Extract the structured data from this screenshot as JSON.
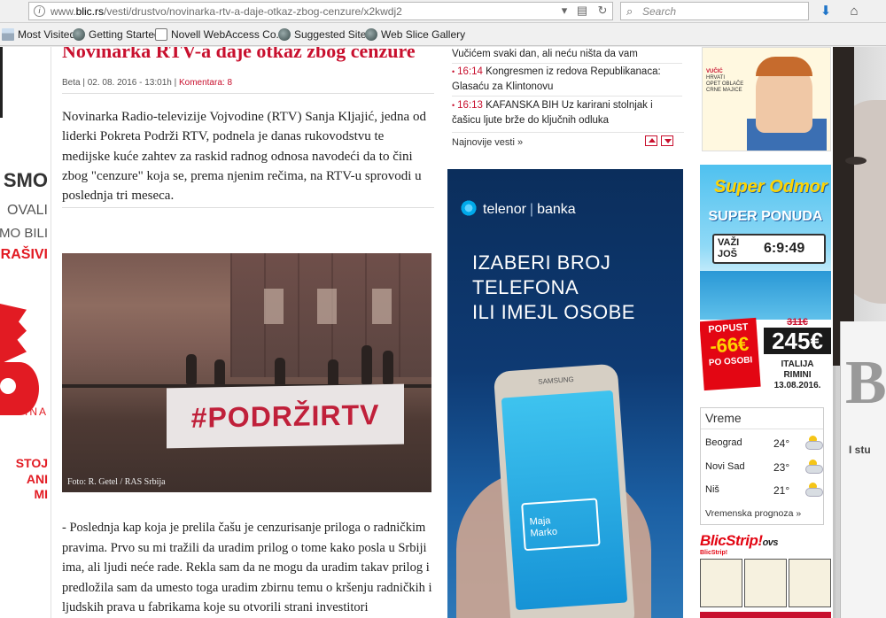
{
  "browser": {
    "url_prefix": "www.",
    "url_host": "blic.rs",
    "url_path": "/vesti/drustvo/novinarka-rtv-a-daje-otkaz-zbog-cenzure/x2kwdj2",
    "search_placeholder": "Search"
  },
  "bookmarks": [
    {
      "label": "Most Visited"
    },
    {
      "label": "Getting Started"
    },
    {
      "label": "Novell WebAccess Co..."
    },
    {
      "label": "Suggested Sites"
    },
    {
      "label": "Web Slice Gallery"
    }
  ],
  "left_skin": {
    "lines": [
      "SMO",
      "OVALI",
      "MO BILI",
      "RAŠIVI",
      "INA",
      "STOJ",
      "ANI",
      "MI"
    ]
  },
  "article": {
    "headline": "Novinarka RTV-a daje otkaz zbog cenzure",
    "source": "Beta",
    "date": "02. 08. 2016 - 13:01h",
    "comments": "Komentara: 8",
    "lead": "Novinarka Radio-televizije Vojvodine (RTV) Sanja Kljajić, jedna od liderki Pokreta Podrži RTV, podnela je danas rukovodstvu te medijske kuće zahtev za raskid radnog odnosa navodeći da to čini zbog \"cenzure\" koja se, prema njenim rečima, na RTV-u sprovodi u poslednja tri meseca.",
    "photo_banner": "#PODRŽIRTV",
    "photo_credit": "Foto: R. Getel / RAS Srbija",
    "body": "- Poslednja kap koja je prelila čašu je cenzurisanje priloga o radničkim pravima. Prvo su mi tražili da uradim prilog o tome kako posla u Srbiji ima, ali ljudi neće rade. Rekla sam da ne mogu da uradim takav prilog i predložila sam da umesto toga uradim zbirnu temu o kršenju radničkih i ljudskih prava u fabrikama koje su otvorili strani investitori"
  },
  "latest_news": {
    "items": [
      {
        "time": "",
        "text": "Vučićem svaki dan, ali neću ništa da vam"
      },
      {
        "time": "16:14",
        "text": "Kongresmen iz redova Republikanaca: Glasaću za Klintonovu"
      },
      {
        "time": "16:13",
        "text": "KAFANSKA BIH Uz karirani stolnjak i čašicu ljute brže do ključnih odluka"
      }
    ],
    "more_label": "Najnovije vesti »"
  },
  "telenor_ad": {
    "brand": "telenor",
    "brand2": "banka",
    "headline": [
      "IZABERI BROJ",
      "TELEFONA",
      "ILI IMEJL OSOBE"
    ],
    "phone_brand": "SAMSUNG",
    "contact": [
      "Maja",
      "Marko"
    ]
  },
  "magazine": {
    "side_text": [
      "VUČIĆ",
      "HRVATI",
      "OPET OBLAČE",
      "CRNE MAJICE"
    ]
  },
  "super_odmor": {
    "title": "Super Odmor",
    "offer": "SUPER PONUDA",
    "still_label_1": "VAŽI",
    "still_label_2": "JOŠ",
    "countdown": "6:9:49",
    "discount_label": "POPUST",
    "discount": "-66€",
    "discount_sub": "PO OSOBI",
    "old_price": "311€",
    "new_price": "245€",
    "country": "ITALIJA",
    "city": "RIMINI",
    "date": "13.08.2016."
  },
  "weather": {
    "title": "Vreme",
    "cities": [
      {
        "name": "Beograd",
        "temp": "24°"
      },
      {
        "name": "Novi Sad",
        "temp": "23°"
      },
      {
        "name": "Niš",
        "temp": "21°"
      }
    ],
    "forecast_link": "Vremenska prognoza »"
  },
  "blicstrip": {
    "logo": "BlicStrip!",
    "logo_suffix": "ovs",
    "sub": "BlicStrip!"
  },
  "right_skin": {
    "big_letter": "B",
    "title": "I stu"
  }
}
